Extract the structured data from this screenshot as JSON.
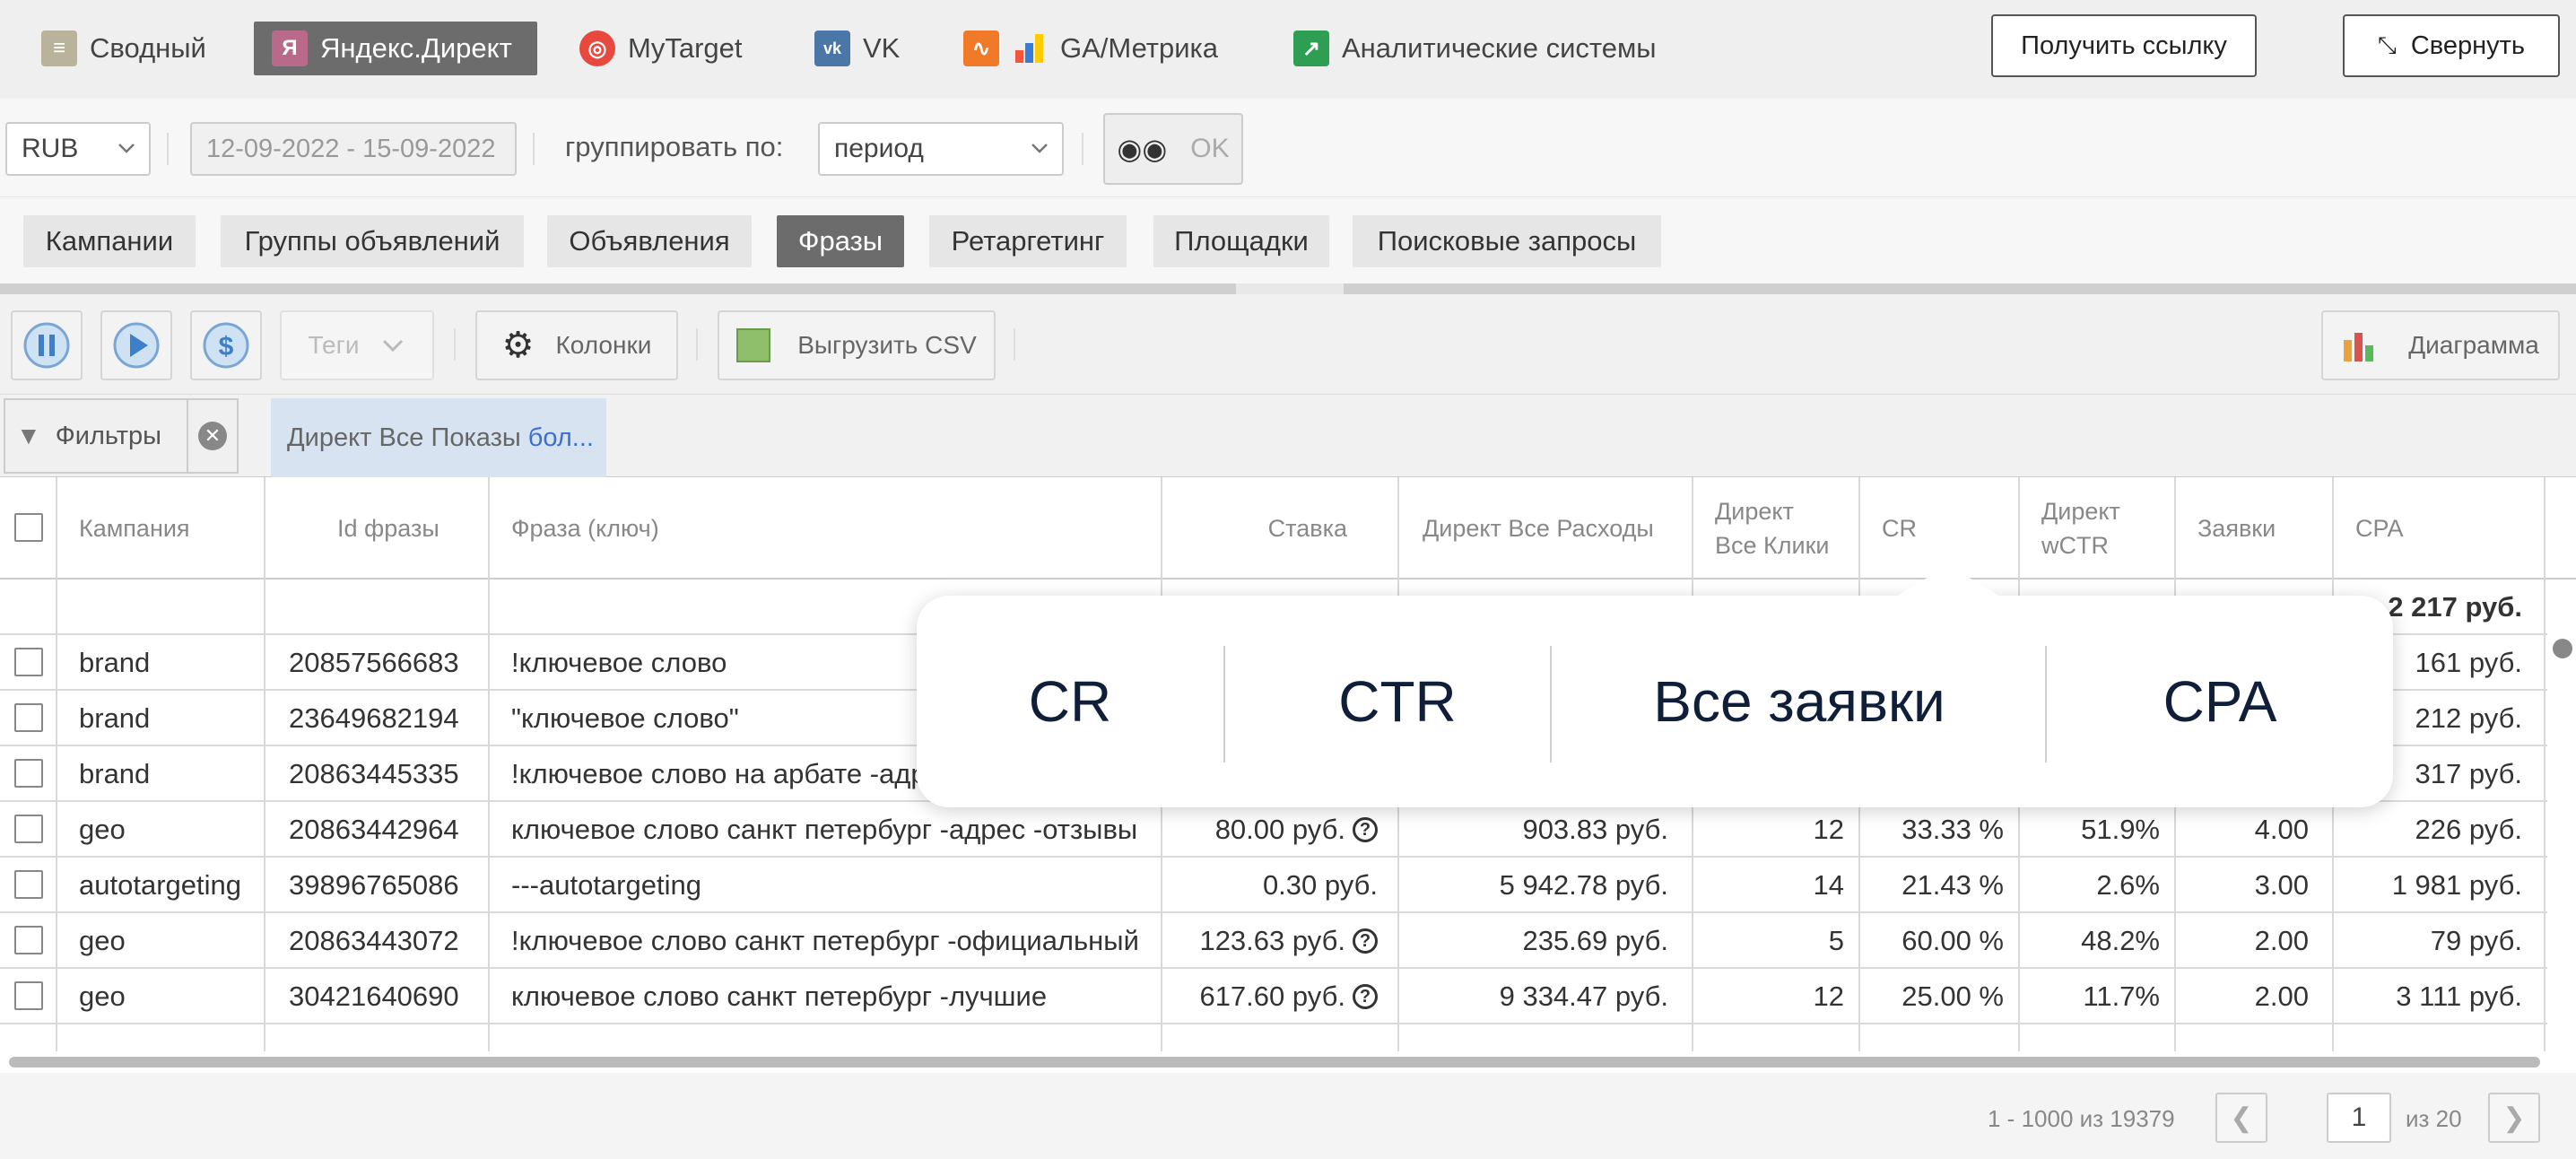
{
  "top_tabs": [
    {
      "label": "Сводный",
      "icon": "stack-icon",
      "active": false
    },
    {
      "label": "Яндекс.Директ",
      "icon": "yandex-icon",
      "active": true
    },
    {
      "label": "MyTarget",
      "icon": "mytarget-icon",
      "active": false
    },
    {
      "label": "VK",
      "icon": "vk-icon",
      "active": false
    },
    {
      "label": "GA/Метрика",
      "icon": "ga-metrika-icon",
      "active": false
    },
    {
      "label": "Аналитические системы",
      "icon": "analytics-icon",
      "active": false
    }
  ],
  "top_buttons": {
    "get_link": "Получить ссылку",
    "collapse": "Свернуть"
  },
  "filter_row": {
    "currency": "RUB",
    "date_range": "12-09-2022 - 15-09-2022",
    "group_by_label": "группировать по:",
    "group_by_value": "период",
    "ok": "OK"
  },
  "level_tabs": [
    {
      "label": "Кампании",
      "active": false
    },
    {
      "label": "Группы объявлений",
      "active": false
    },
    {
      "label": "Объявления",
      "active": false
    },
    {
      "label": "Фразы",
      "active": true
    },
    {
      "label": "Ретаргетинг",
      "active": false
    },
    {
      "label": "Площадки",
      "active": false
    },
    {
      "label": "Поисковые запросы",
      "active": false
    }
  ],
  "toolbar": {
    "tags": "Теги",
    "columns": "Колонки",
    "export_csv": "Выгрузить CSV",
    "chart": "Диаграмма"
  },
  "filters": {
    "label": "Фильтры",
    "chip_text": "Директ Все Показы",
    "chip_more": "бол..."
  },
  "table": {
    "headers": {
      "campaign": "Кампания",
      "phrase_id": "Id фразы",
      "phrase": "Фраза (ключ)",
      "bid": "Ставка",
      "spend": "Директ Все Расходы",
      "clicks_1": "Директ",
      "clicks_2": "Все Клики",
      "cr": "CR",
      "wctr_1": "Директ",
      "wctr_2": "wCTR",
      "leads": "Заявки",
      "cpa": "CPA"
    },
    "total_cpa": "2 217 руб.",
    "rows": [
      {
        "campaign": "brand",
        "id": "20857566683",
        "phrase": "!ключевое слово",
        "bid": "",
        "spend": "",
        "clicks": "",
        "cr": "",
        "wctr": "",
        "leads": "",
        "cpa": "161 руб."
      },
      {
        "campaign": "brand",
        "id": "23649682194",
        "phrase": "\"ключевое слово\"",
        "bid": "",
        "spend": "",
        "clicks": "",
        "cr": "",
        "wctr": "",
        "leads": "",
        "cpa": "212 руб."
      },
      {
        "campaign": "brand",
        "id": "20863445335",
        "phrase": "!ключевое слово на арбате -адрес",
        "bid": "",
        "spend": "",
        "clicks": "",
        "cr": "",
        "wctr": "",
        "leads": "",
        "cpa": "317 руб."
      },
      {
        "campaign": "geo",
        "id": "20863442964",
        "phrase": "ключевое слово санкт петербург -адрес -отзывы",
        "bid": "80.00 руб.",
        "spend": "903.83 руб.",
        "clicks": "12",
        "cr": "33.33 %",
        "wctr": "51.9%",
        "leads": "4.00",
        "cpa": "226 руб."
      },
      {
        "campaign": "autotargeting",
        "id": "39896765086",
        "phrase": "---autotargeting",
        "bid": "0.30 руб.",
        "spend": "5 942.78 руб.",
        "clicks": "14",
        "cr": "21.43 %",
        "wctr": "2.6%",
        "leads": "3.00",
        "cpa": "1 981 руб."
      },
      {
        "campaign": "geo",
        "id": "20863443072",
        "phrase": "!ключевое слово санкт петербург -официальный",
        "bid": "123.63 руб.",
        "spend": "235.69 руб.",
        "clicks": "5",
        "cr": "60.00 %",
        "wctr": "48.2%",
        "leads": "2.00",
        "cpa": "79 руб."
      },
      {
        "campaign": "geo",
        "id": "30421640690",
        "phrase": "ключевое слово санкт петербург -лучшие",
        "bid": "617.60 руб.",
        "spend": "9 334.47 руб.",
        "clicks": "12",
        "cr": "25.00 %",
        "wctr": "11.7%",
        "leads": "2.00",
        "cpa": "3 111 руб."
      }
    ]
  },
  "popup": {
    "items": [
      "CR",
      "CTR",
      "Все заявки",
      "CPA"
    ]
  },
  "footer": {
    "range": "1 - 1000 из 19379",
    "page": "1",
    "of": "из 20"
  }
}
